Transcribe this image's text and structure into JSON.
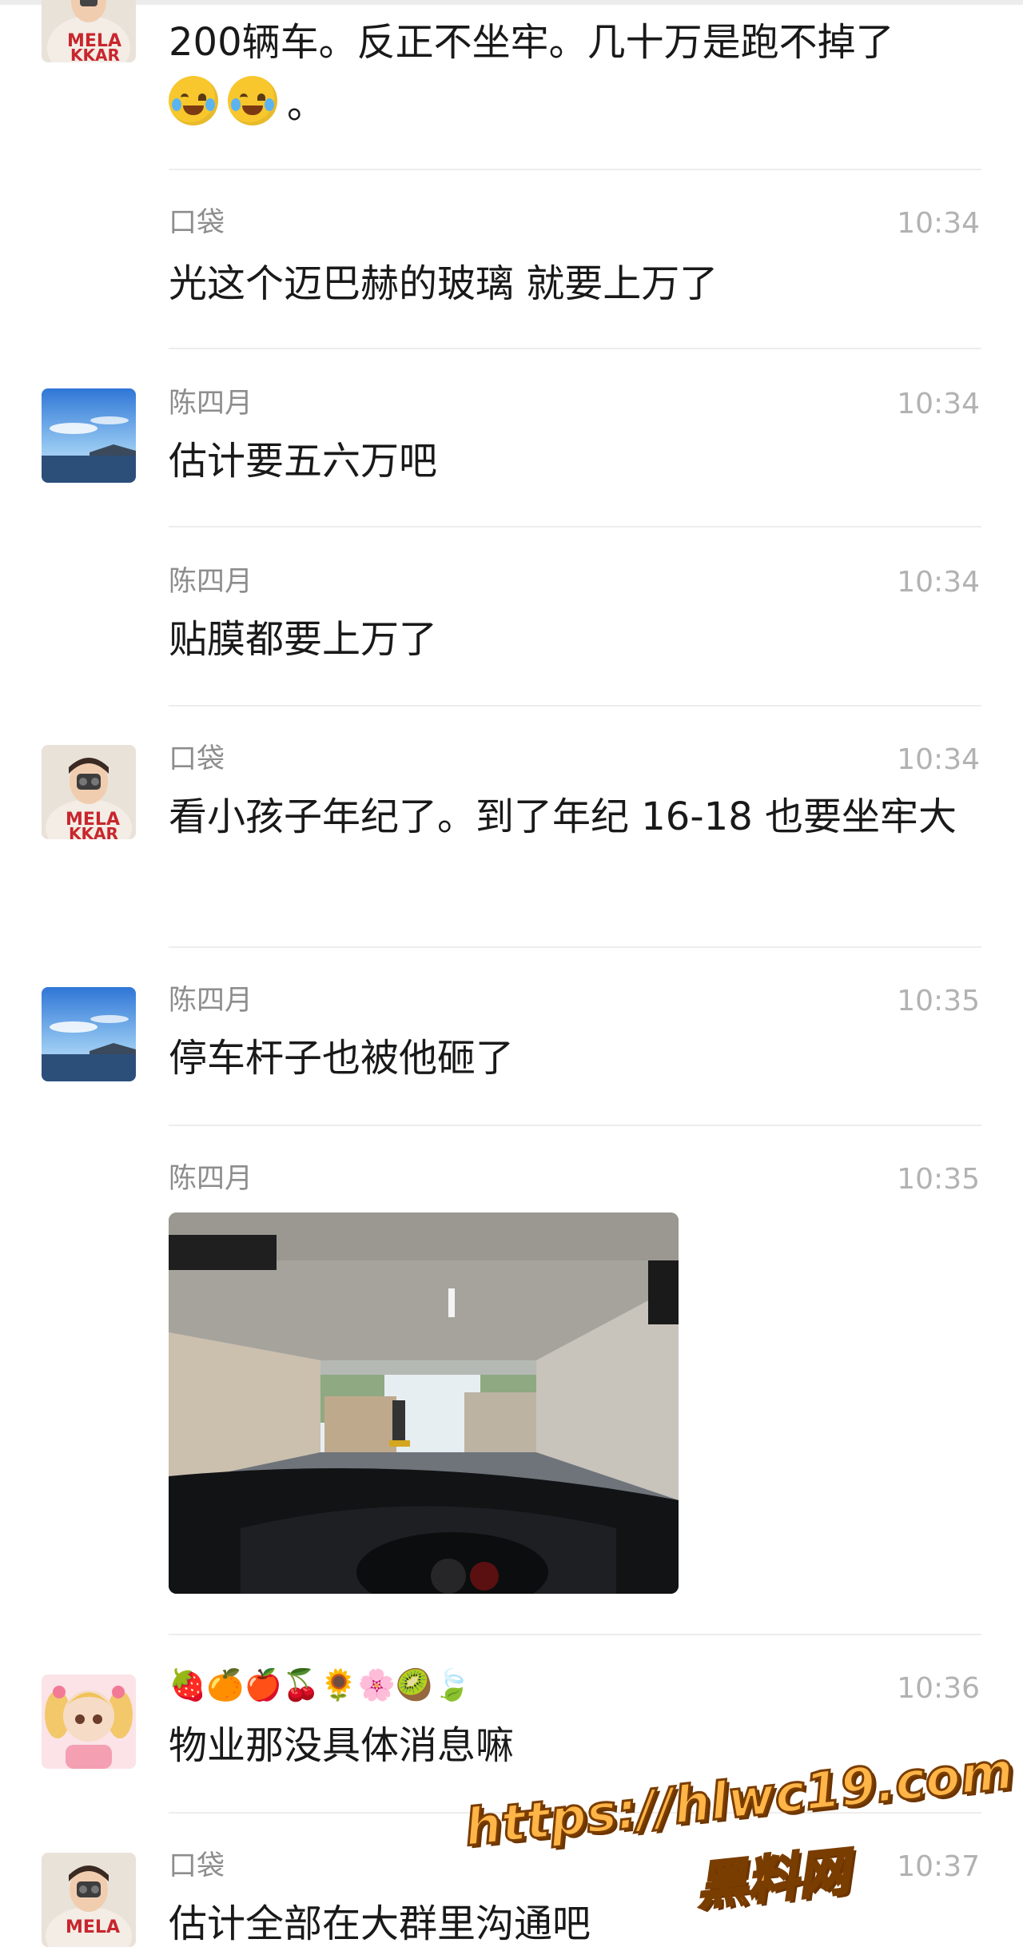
{
  "messages": [
    {
      "text": "200辆车。反正不坐牢。几十万是跑不掉了",
      "suffix": "。",
      "emoji": [
        "face-with-tears-emoji",
        "face-with-tears-emoji"
      ]
    },
    {
      "sender": "口袋",
      "time": "10:34",
      "text": "光这个迈巴赫的玻璃 就要上万了"
    },
    {
      "sender": "陈四月",
      "time": "10:34",
      "text": "估计要五六万吧"
    },
    {
      "sender": "陈四月",
      "time": "10:34",
      "text": "贴膜都要上万了"
    },
    {
      "sender": "口袋",
      "time": "10:34",
      "text": "看小孩子年纪了。到了年纪 16-18 也要坐牢大"
    },
    {
      "sender": "陈四月",
      "time": "10:35",
      "text": "停车杆子也被他砸了"
    },
    {
      "sender": "陈四月",
      "time": "10:35",
      "image": "garage-exit-photo"
    },
    {
      "sender": "🍓🍊🍎🍒🌻🌸🥝🍃",
      "time": "10:36",
      "text": "物业那没具体消息嘛"
    },
    {
      "sender": "口袋",
      "time": "10:37",
      "text": "估计全部在大群里沟通吧"
    }
  ],
  "watermark": {
    "url": "https://hlwc19.com",
    "name": "黑料网",
    "color": "#ffb547"
  },
  "colors": {
    "sender": "#8d8d8d",
    "time": "#b2b2b2",
    "text": "#191919",
    "divider": "#ededed"
  }
}
